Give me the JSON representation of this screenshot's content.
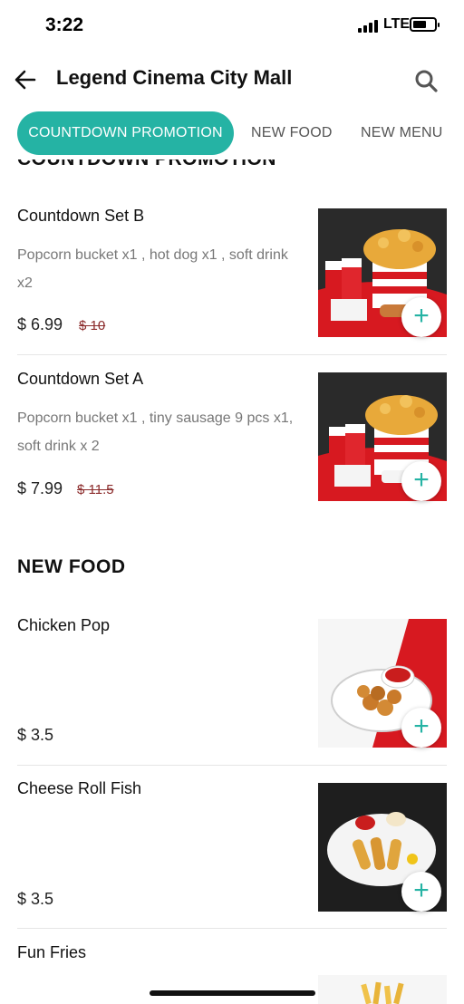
{
  "status_bar": {
    "time": "3:22",
    "network": "LTE"
  },
  "header": {
    "title": "Legend Cinema City Mall",
    "back_icon": "arrow-left-icon",
    "search_icon": "search-icon"
  },
  "tabs": [
    {
      "label": "COUNTDOWN PROMOTION",
      "active": true
    },
    {
      "label": "NEW FOOD",
      "active": false
    },
    {
      "label": "NEW MENU",
      "active": false
    }
  ],
  "sections": [
    {
      "title": "COUNTDOWN PROMOTION",
      "items": [
        {
          "name": "Countdown Set B",
          "description": "Popcorn bucket x1 , hot dog x1 , soft drink x2",
          "price": "$ 6.99",
          "old_price": "$ 10"
        },
        {
          "name": "Countdown Set A",
          "description": "Popcorn bucket x1 , tiny sausage 9 pcs x1, soft drink x 2",
          "price": "$ 7.99",
          "old_price": "$ 11.5"
        }
      ]
    },
    {
      "title": "NEW FOOD",
      "items": [
        {
          "name": "Chicken Pop",
          "description": "",
          "price": "$ 3.5",
          "old_price": ""
        },
        {
          "name": "Cheese Roll Fish",
          "description": "",
          "price": "$ 3.5",
          "old_price": ""
        },
        {
          "name": "Fun Fries",
          "description": "",
          "price": "",
          "old_price": ""
        }
      ]
    }
  ],
  "colors": {
    "accent": "#25b3a4",
    "promo_bg": "#d71920",
    "strike": "#8b2b2b"
  }
}
